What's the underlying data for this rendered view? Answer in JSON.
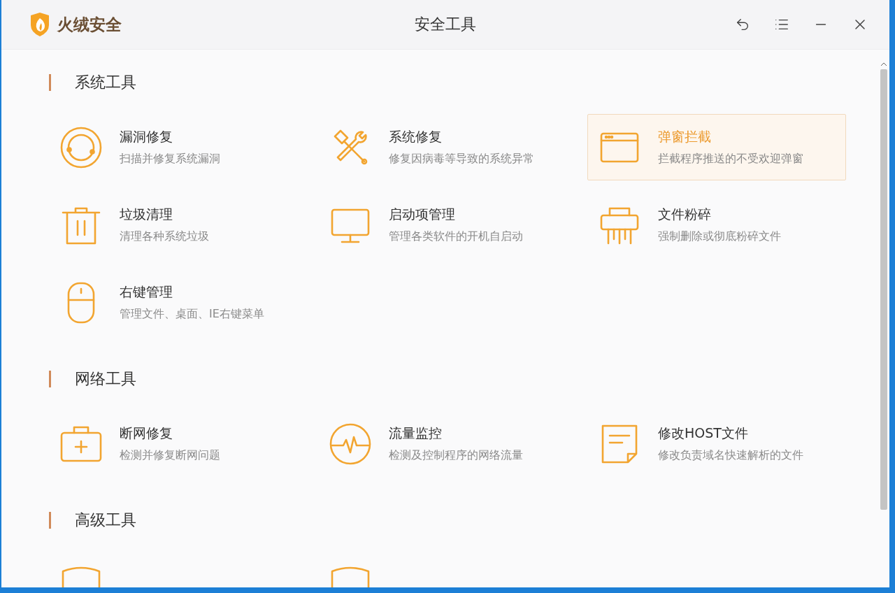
{
  "window": {
    "app_name": "火绒安全",
    "title": "安全工具"
  },
  "sections": [
    {
      "title": "系统工具",
      "items": [
        {
          "kind": "tool",
          "title": "漏洞修复",
          "description": "扫描并修复系统漏洞",
          "selected": false
        },
        {
          "kind": "tool",
          "title": "系统修复",
          "description": "修复因病毒等导致的系统异常",
          "selected": false
        },
        {
          "kind": "tool",
          "title": "弹窗拦截",
          "description": "拦截程序推送的不受欢迎弹窗",
          "selected": true
        },
        {
          "kind": "tool",
          "title": "垃圾清理",
          "description": "清理各种系统垃圾",
          "selected": false
        },
        {
          "kind": "tool",
          "title": "启动项管理",
          "description": "管理各类软件的开机自启动",
          "selected": false
        },
        {
          "kind": "tool",
          "title": "文件粉碎",
          "description": "强制删除或彻底粉碎文件",
          "selected": false
        },
        {
          "kind": "tool",
          "title": "右键管理",
          "description": "管理文件、桌面、IE右键菜单",
          "selected": false
        }
      ]
    },
    {
      "title": "网络工具",
      "items": [
        {
          "kind": "tool",
          "title": "断网修复",
          "description": "检测并修复断网问题",
          "selected": false
        },
        {
          "kind": "tool",
          "title": "流量监控",
          "description": "检测及控制程序的网络流量",
          "selected": false
        },
        {
          "kind": "tool",
          "title": "修改HOST文件",
          "description": "修改负责域名快速解析的文件",
          "selected": false
        }
      ]
    },
    {
      "title": "高级工具",
      "items": [
        {
          "kind": "cut"
        },
        {
          "kind": "cut"
        }
      ]
    }
  ]
}
